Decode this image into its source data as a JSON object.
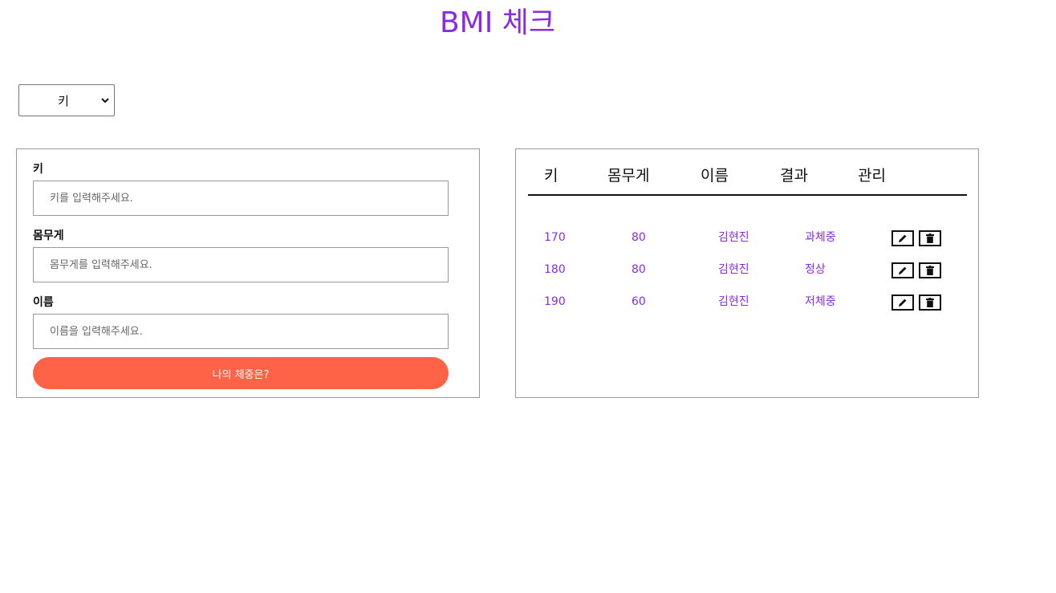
{
  "title": "BMI 체크",
  "sort_select": {
    "selected": "키"
  },
  "form": {
    "height": {
      "label": "키",
      "placeholder": "키를 입력해주세요."
    },
    "weight": {
      "label": "몸무게",
      "placeholder": "몸무게를 입력해주세요."
    },
    "name": {
      "label": "이름",
      "placeholder": "이름을 입력해주세요."
    },
    "submit_label": "나의 체중은?"
  },
  "list": {
    "headers": [
      "키",
      "몸무게",
      "이름",
      "결과",
      "관리"
    ],
    "rows": [
      {
        "height": "170",
        "weight": "80",
        "name": "김현진",
        "result": "과체중"
      },
      {
        "height": "180",
        "weight": "80",
        "name": "김현진",
        "result": "정상"
      },
      {
        "height": "190",
        "weight": "60",
        "name": "김현진",
        "result": "저체중"
      }
    ]
  },
  "colors": {
    "accent": "#8a2be2",
    "button": "#ff6347"
  }
}
